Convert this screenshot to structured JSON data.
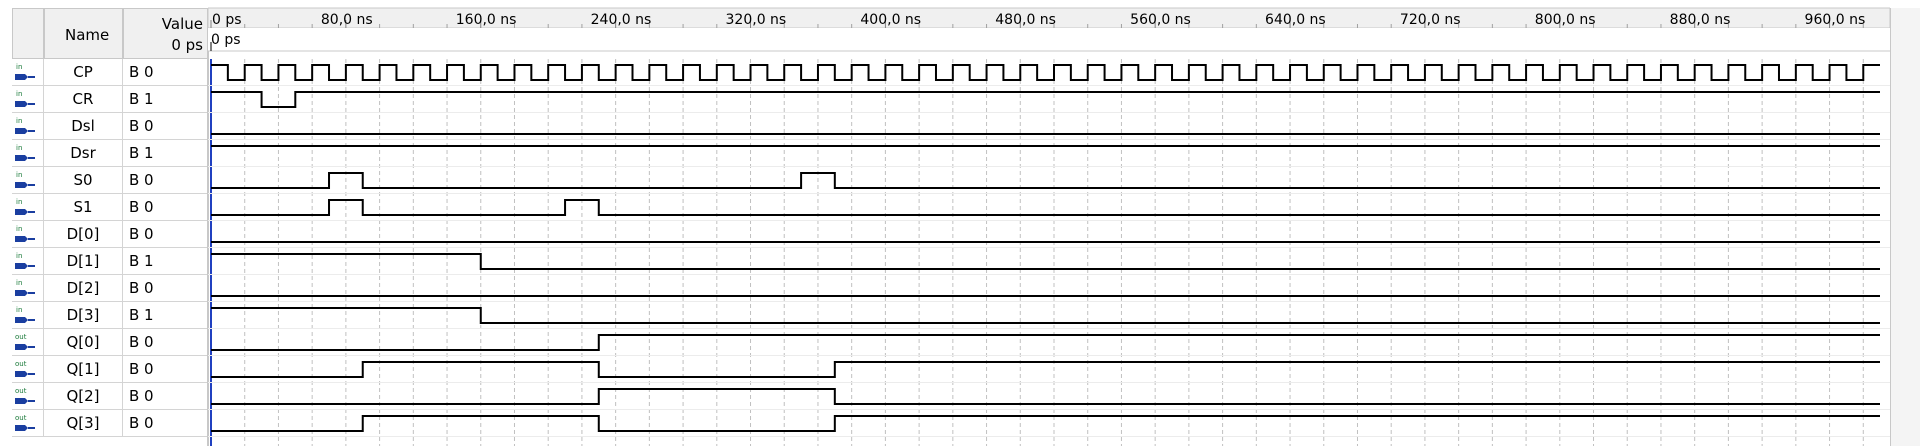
{
  "header": {
    "name_label": "Name",
    "value_label": "Value",
    "value_time": "0 ps",
    "cursor_time": "0 ps"
  },
  "time_axis": {
    "unit": "ns",
    "tick_labels": [
      "0 ps",
      "80,0 ns",
      "160,0 ns",
      "240,0 ns",
      "320,0 ns",
      "400,0 ns",
      "480,0 ns",
      "560,0 ns",
      "640,0 ns",
      "720,0 ns",
      "800,0 ns",
      "880,0 ns",
      "960,0 ns"
    ],
    "range_ns": [
      0,
      1000
    ],
    "clock_period_ns": 20
  },
  "signals": [
    {
      "name": "CP",
      "dir": "in",
      "value": "B 0",
      "type": "clock",
      "icon": "input-pin-icon"
    },
    {
      "name": "CR",
      "dir": "in",
      "value": "B 1",
      "type": "wave",
      "init": 1,
      "edges": [
        30,
        50
      ],
      "icon": "input-pin-icon"
    },
    {
      "name": "Dsl",
      "dir": "in",
      "value": "B 0",
      "type": "wave",
      "init": 0,
      "edges": [],
      "icon": "input-pin-icon"
    },
    {
      "name": "Dsr",
      "dir": "in",
      "value": "B 1",
      "type": "wave",
      "init": 1,
      "edges": [],
      "icon": "input-pin-icon"
    },
    {
      "name": "S0",
      "dir": "in",
      "value": "B 0",
      "type": "wave",
      "init": 0,
      "edges": [
        70,
        90,
        350,
        370
      ],
      "icon": "input-pin-icon"
    },
    {
      "name": "S1",
      "dir": "in",
      "value": "B 0",
      "type": "wave",
      "init": 0,
      "edges": [
        70,
        90,
        210,
        230
      ],
      "icon": "input-pin-icon"
    },
    {
      "name": "D[0]",
      "dir": "in",
      "value": "B 0",
      "type": "wave",
      "init": 0,
      "edges": [],
      "icon": "input-pin-icon"
    },
    {
      "name": "D[1]",
      "dir": "in",
      "value": "B 1",
      "type": "wave",
      "init": 1,
      "edges": [
        160
      ],
      "icon": "input-pin-icon"
    },
    {
      "name": "D[2]",
      "dir": "in",
      "value": "B 0",
      "type": "wave",
      "init": 0,
      "edges": [],
      "icon": "input-pin-icon"
    },
    {
      "name": "D[3]",
      "dir": "in",
      "value": "B 1",
      "type": "wave",
      "init": 1,
      "edges": [
        160
      ],
      "icon": "input-pin-icon"
    },
    {
      "name": "Q[0]",
      "dir": "out",
      "value": "B 0",
      "type": "wave",
      "init": 0,
      "edges": [
        230
      ],
      "icon": "output-pin-icon"
    },
    {
      "name": "Q[1]",
      "dir": "out",
      "value": "B 0",
      "type": "wave",
      "init": 0,
      "edges": [
        90,
        230,
        370
      ],
      "icon": "output-pin-icon"
    },
    {
      "name": "Q[2]",
      "dir": "out",
      "value": "B 0",
      "type": "wave",
      "init": 0,
      "edges": [
        230,
        370
      ],
      "icon": "output-pin-icon"
    },
    {
      "name": "Q[3]",
      "dir": "out",
      "value": "B 0",
      "type": "wave",
      "init": 0,
      "edges": [
        90,
        230,
        370
      ],
      "icon": "output-pin-icon"
    }
  ],
  "colors": {
    "wave": "#000000",
    "grid": "#c0c0c0",
    "cursor": "#2040c0",
    "pin_in": "#1a3ea0",
    "pin_out": "#1a3ea0",
    "pin_label": "#1a7a3a"
  }
}
